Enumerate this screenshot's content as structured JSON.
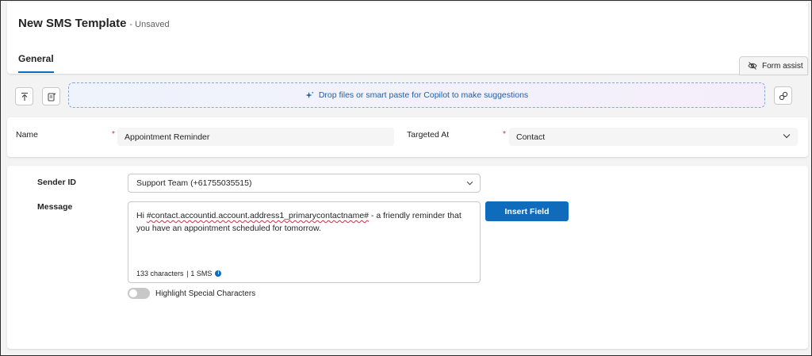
{
  "header": {
    "title": "New SMS Template",
    "status": "- Unsaved",
    "tabs": [
      {
        "label": "General"
      }
    ],
    "form_assist_label": "Form assist"
  },
  "toolbar": {
    "dropzone_text": "Drop files or smart paste for Copilot to make suggestions"
  },
  "fields": {
    "name_label": "Name",
    "name_value": "Appointment Reminder",
    "targeted_label": "Targeted At",
    "targeted_value": "Contact",
    "required_marker": "*"
  },
  "sms": {
    "sender_label": "Sender ID",
    "sender_value": "Support Team (+61755035515)",
    "message_label": "Message",
    "message_prefix": "Hi ",
    "message_token": "#contact.accountid.account.address1_primarycontactname#",
    "message_rest": " - a friendly reminder that you have an appointment scheduled for tomorrow.",
    "char_count": "133 characters",
    "sms_count": "| 1 SMS",
    "insert_button": "Insert Field",
    "highlight_label": "Highlight Special Characters",
    "highlight_on": false
  },
  "colors": {
    "accent": "#0f6cbd",
    "required": "#c4314b"
  }
}
